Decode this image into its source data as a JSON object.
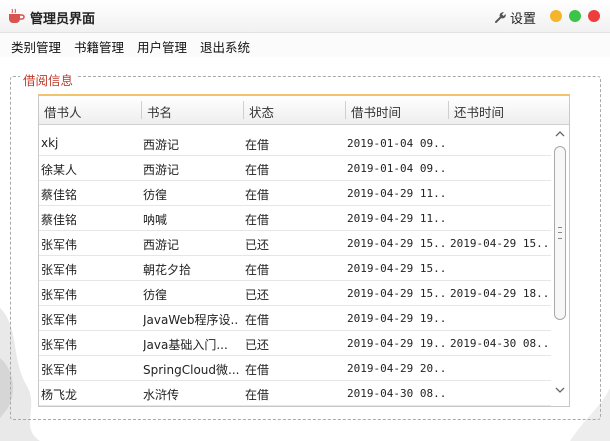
{
  "window": {
    "title": "管理员界面",
    "settings_label": "设置",
    "icons": {
      "app": "coffee-cup-icon",
      "settings": "wrench-icon"
    },
    "controls": {
      "minimize_color": "#f5b52a",
      "maximize_color": "#3cc44a",
      "close_color": "#ee3d3d"
    }
  },
  "menu": {
    "items": [
      "类别管理",
      "书籍管理",
      "用户管理",
      "退出系统"
    ]
  },
  "borrow": {
    "group_title": "借阅信息",
    "accent_color": "#c0392b",
    "columns": [
      "借书人",
      "书名",
      "状态",
      "借书时间",
      "还书时间"
    ],
    "rows": [
      {
        "borrower": "xkj",
        "book": "西游记",
        "status": "在借",
        "borrow_time": "2019-01-04 09...",
        "return_time": ""
      },
      {
        "borrower": "徐某人",
        "book": "西游记",
        "status": "在借",
        "borrow_time": "2019-01-04 09...",
        "return_time": ""
      },
      {
        "borrower": "蔡佳铭",
        "book": "彷徨",
        "status": "在借",
        "borrow_time": "2019-04-29 11...",
        "return_time": ""
      },
      {
        "borrower": "蔡佳铭",
        "book": "呐喊",
        "status": "在借",
        "borrow_time": "2019-04-29 11...",
        "return_time": ""
      },
      {
        "borrower": "张军伟",
        "book": "西游记",
        "status": "已还",
        "borrow_time": "2019-04-29 15...",
        "return_time": "2019-04-29 15..."
      },
      {
        "borrower": "张军伟",
        "book": "朝花夕拾",
        "status": "在借",
        "borrow_time": "2019-04-29 15...",
        "return_time": ""
      },
      {
        "borrower": "张军伟",
        "book": "彷徨",
        "status": "已还",
        "borrow_time": "2019-04-29 15...",
        "return_time": "2019-04-29 18..."
      },
      {
        "borrower": "张军伟",
        "book": "JavaWeb程序设...",
        "status": "在借",
        "borrow_time": "2019-04-29 19...",
        "return_time": ""
      },
      {
        "borrower": "张军伟",
        "book": "Java基础入门...",
        "status": "已还",
        "borrow_time": "2019-04-29 19...",
        "return_time": "2019-04-30 08..."
      },
      {
        "borrower": "张军伟",
        "book": "SpringCloud微...",
        "status": "在借",
        "borrow_time": "2019-04-29 20...",
        "return_time": ""
      },
      {
        "borrower": "杨飞龙",
        "book": "水浒传",
        "status": "在借",
        "borrow_time": "2019-04-30 08...",
        "return_time": ""
      }
    ]
  }
}
